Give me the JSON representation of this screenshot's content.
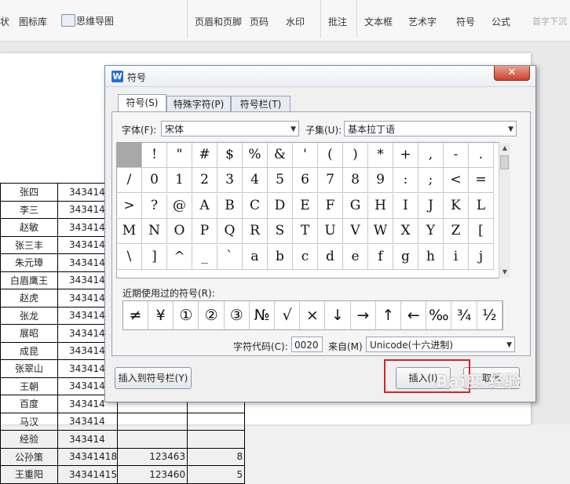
{
  "ribbon": {
    "items": [
      {
        "label": "状"
      },
      {
        "label": "图标库"
      },
      {
        "label": "思维导图"
      },
      {
        "label": "页眉和页脚"
      },
      {
        "label": "页码"
      },
      {
        "label": "水印"
      },
      {
        "label": "批注"
      },
      {
        "label": "文本框"
      },
      {
        "label": "艺术字"
      },
      {
        "label": "符号"
      },
      {
        "label": "公式"
      },
      {
        "label": "首字下沉"
      }
    ]
  },
  "sheet": {
    "rows": [
      {
        "name": "张四",
        "code": "343414"
      },
      {
        "name": "李三",
        "code": "343414"
      },
      {
        "name": "赵敏",
        "code": "343414"
      },
      {
        "name": "张三丰",
        "code": "343414"
      },
      {
        "name": "朱元璋",
        "code": "343414"
      },
      {
        "name": "白眉鹰王",
        "code": "343414"
      },
      {
        "name": "赵虎",
        "code": "343414"
      },
      {
        "name": "张龙",
        "code": "343414"
      },
      {
        "name": "展昭",
        "code": "343414"
      },
      {
        "name": "成昆",
        "code": "343414"
      },
      {
        "name": "张翠山",
        "code": "343414"
      },
      {
        "name": "王朝",
        "code": "343414"
      },
      {
        "name": "百度",
        "code": "343414"
      },
      {
        "name": "马汉",
        "code": "343414"
      },
      {
        "name": "经验",
        "code": "343414"
      },
      {
        "name": "公孙策",
        "code": "34341418",
        "num": "123463",
        "qty": "8"
      },
      {
        "name": "王重阳",
        "code": "34341415",
        "num": "123460",
        "qty": "5"
      }
    ]
  },
  "dialog": {
    "icon_letter": "W",
    "title": "符号",
    "close_label": "✕",
    "tabs": [
      {
        "label": "符号(S)"
      },
      {
        "label": "特殊字符(P)"
      },
      {
        "label": "符号栏(T)"
      }
    ],
    "font_label": "字体(F):",
    "font_value": "宋体",
    "subset_label": "子集(U):",
    "subset_value": "基本拉丁语",
    "symbols": [
      " ",
      "!",
      "\"",
      "#",
      "$",
      "%",
      "&",
      "'",
      "(",
      ")",
      "*",
      "+",
      ",",
      "-",
      ".",
      "/",
      "0",
      "1",
      "2",
      "3",
      "4",
      "5",
      "6",
      "7",
      "8",
      "9",
      ":",
      ";",
      "<",
      "=",
      ">",
      "?",
      "@",
      "A",
      "B",
      "C",
      "D",
      "E",
      "F",
      "G",
      "H",
      "I",
      "J",
      "K",
      "L",
      "M",
      "N",
      "O",
      "P",
      "Q",
      "R",
      "S",
      "T",
      "U",
      "V",
      "W",
      "X",
      "Y",
      "Z",
      "[",
      "\\",
      "]",
      "^",
      "_",
      "`",
      "a",
      "b",
      "c",
      "d",
      "e",
      "f",
      "g",
      "h",
      "i",
      "j"
    ],
    "recent_label": "近期使用过的符号(R):",
    "recent_symbols": [
      "≠",
      "¥",
      "①",
      "②",
      "③",
      "№",
      "√",
      "×",
      "↓",
      "→",
      "↑",
      "←",
      "‰",
      "¾",
      "½"
    ],
    "charcode_label": "字符代码(C):",
    "charcode_value": "0020",
    "from_label": "来自(M)",
    "from_value": "Unicode(十六进制)",
    "insert_to_bar_label": "插入到符号栏(Y)",
    "insert_label": "插入(I)",
    "cancel_label": "取消",
    "watermark": "Bai度 经验"
  }
}
